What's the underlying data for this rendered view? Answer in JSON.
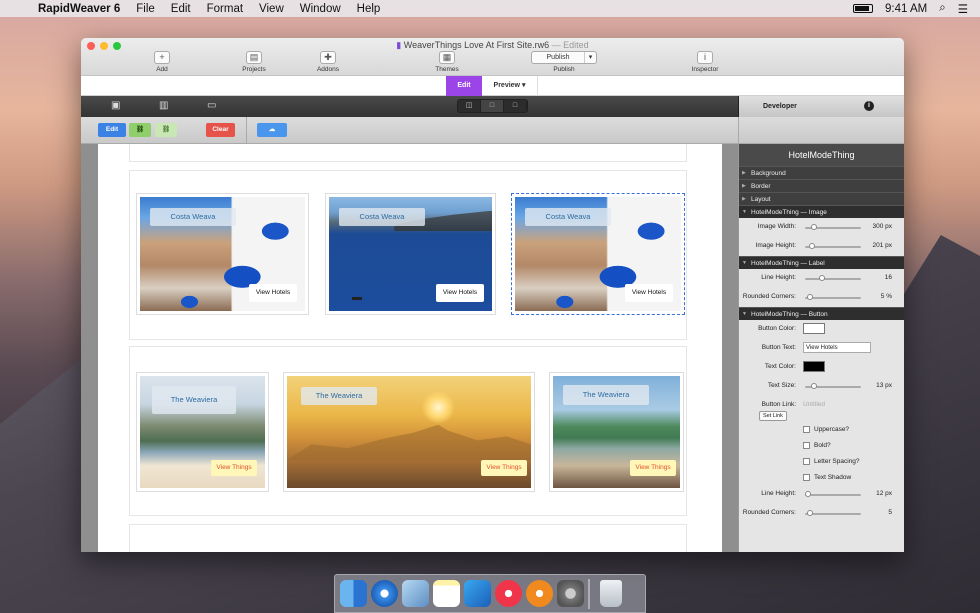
{
  "menubar": {
    "app": "RapidWeaver 6",
    "items": [
      "File",
      "Edit",
      "Format",
      "View",
      "Window",
      "Help"
    ],
    "clock": "9:41 AM"
  },
  "window": {
    "filename": "WeaverThings Love At First Site.rw6",
    "edited": "— Edited"
  },
  "toolbar": {
    "add": "Add",
    "projects": "Projects",
    "addons": "Addons",
    "themes": "Themes",
    "publish_btn": "Publish",
    "publish": "Publish",
    "inspector": "Inspector"
  },
  "modes": {
    "edit": "Edit",
    "preview": "Preview"
  },
  "developer": "Developer",
  "actions": {
    "edit": "Edit",
    "clear": "Clear"
  },
  "cards_row1": [
    {
      "title": "Costa Weava",
      "button": "View Hotels"
    },
    {
      "title": "Costa Weava",
      "button": "View Hotels"
    },
    {
      "title": "Costa Weava",
      "button": "View Hotels"
    }
  ],
  "cards_row2": [
    {
      "title": "The Weaviera",
      "button": "View Things"
    },
    {
      "title": "The Weaviera",
      "button": "View Things"
    },
    {
      "title": "The Weaviera",
      "button": "View Things"
    }
  ],
  "inspector": {
    "title": "HotelModeThing",
    "collapsed": [
      "Background",
      "Border",
      "Layout"
    ],
    "image_section": "HotelModeThing — Image",
    "image_width_label": "Image Width:",
    "image_width": "300 px",
    "image_height_label": "Image Height:",
    "image_height": "201 px",
    "label_section": "HotelModeThing — Label",
    "line_height_label": "Line Height:",
    "line_height": "16",
    "rounded_label": "Rounded Corners:",
    "rounded": "5 %",
    "button_section": "HotelModeThing — Button",
    "button_color_label": "Button Color:",
    "button_text_label": "Button Text:",
    "button_text": "View Hotels",
    "text_color_label": "Text Color:",
    "text_size_label": "Text Size:",
    "text_size": "13 px",
    "button_link_label": "Button Link:",
    "button_link": "Untitled",
    "set_link": "Set Link",
    "checks": [
      "Uppercase?",
      "Bold?",
      "Letter Spacing?",
      "Text Shadow"
    ],
    "btn_line_height_label": "Line Height:",
    "btn_line_height": "12 px",
    "btn_rounded_label": "Rounded Corners:",
    "btn_rounded": "5"
  }
}
